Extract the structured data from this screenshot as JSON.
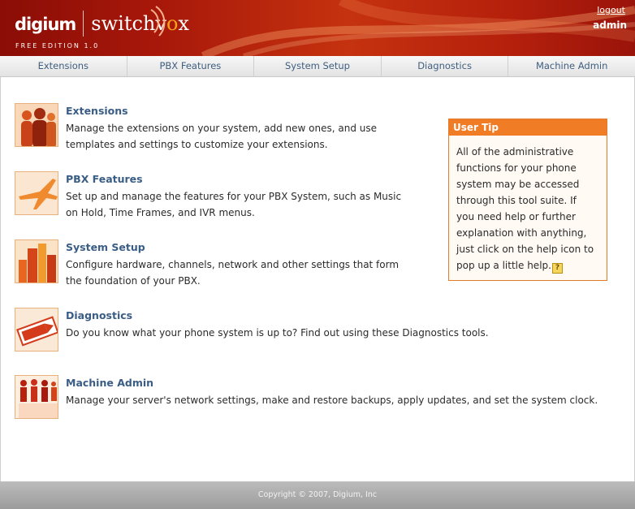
{
  "header": {
    "brand_digium": "digium",
    "brand_switchvox_pre": "switchv",
    "brand_switchvox_dot": "o",
    "brand_switchvox_post": "x",
    "edition": "FREE EDITION 1.0",
    "logout_label": "logout",
    "username": "admin"
  },
  "nav": {
    "items": [
      {
        "label": "Extensions"
      },
      {
        "label": "PBX Features"
      },
      {
        "label": "System Setup"
      },
      {
        "label": "Diagnostics"
      },
      {
        "label": "Machine Admin"
      }
    ]
  },
  "sections": [
    {
      "title": "Extensions",
      "line1": "Manage the extensions on your system, add new ones, and use",
      "line2": "templates and settings to customize your extensions."
    },
    {
      "title": "PBX Features",
      "line1": "Set up and manage the features for your PBX System, such as Music",
      "line2": "on Hold, Time Frames, and IVR menus."
    },
    {
      "title": "System Setup",
      "line1": "Configure hardware, channels, network and other settings that form",
      "line2": "the foundation of your PBX."
    },
    {
      "title": "Diagnostics",
      "line1": "Do you know what your phone system is up to? Find out using these Diagnostics tools.",
      "line2": ""
    },
    {
      "title": "Machine Admin",
      "line1": "Manage your server's network settings, make and restore backups, apply updates, and set the system clock.",
      "line2": ""
    }
  ],
  "tip": {
    "title": "User Tip",
    "lines": [
      "All of the administrative",
      "functions for your phone",
      "system may be accessed",
      "through this tool suite. If",
      "you need help or further",
      "explanation with anything,",
      "just click on the help icon to",
      "pop up a little help."
    ],
    "help_glyph": "?"
  },
  "footer": {
    "copyright": "Copyright © 2007, Digium, Inc"
  },
  "colors": {
    "header_red": "#a8180a",
    "accent_orange": "#f07d26",
    "link_blue": "#3a5d86",
    "nav_text": "#3f5e7f"
  },
  "icons": [
    "extensions-people-icon",
    "pbx-airplane-icon",
    "system-buildings-icon",
    "diagnostics-sign-icon",
    "machine-admin-figures-icon",
    "help-icon"
  ]
}
